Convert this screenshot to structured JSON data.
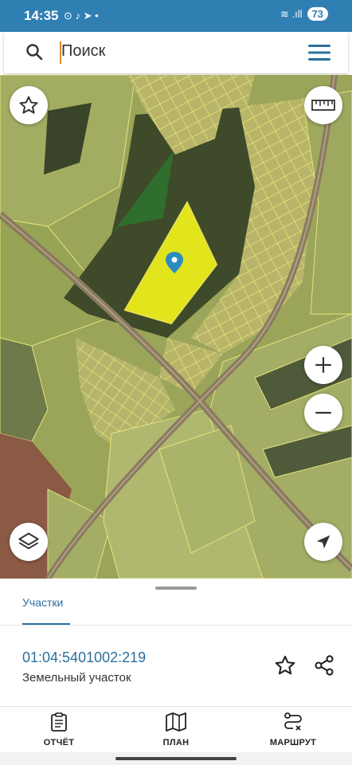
{
  "status_bar": {
    "time": "14:35",
    "notif_icons": "⊙ ♪ ➤ •",
    "signal": "≋ .ıll",
    "battery": "73"
  },
  "search": {
    "placeholder": "Поиск"
  },
  "map": {
    "controls": [
      "star-icon",
      "ruler-icon",
      "zoom-in-icon",
      "zoom-out-icon",
      "layers-icon",
      "locate-icon"
    ],
    "selected_parcel_color": "#ffff1a",
    "accent": "#2b6f9f"
  },
  "tabs": {
    "active": "Участки"
  },
  "parcel": {
    "cadastral_number": "01:04:5401002:219",
    "type": "Земельный участок"
  },
  "bottom_nav": [
    {
      "label": "ОТЧЁТ",
      "icon": "clipboard-icon"
    },
    {
      "label": "ПЛАН",
      "icon": "map-icon"
    },
    {
      "label": "МАРШРУТ",
      "icon": "route-icon"
    }
  ]
}
